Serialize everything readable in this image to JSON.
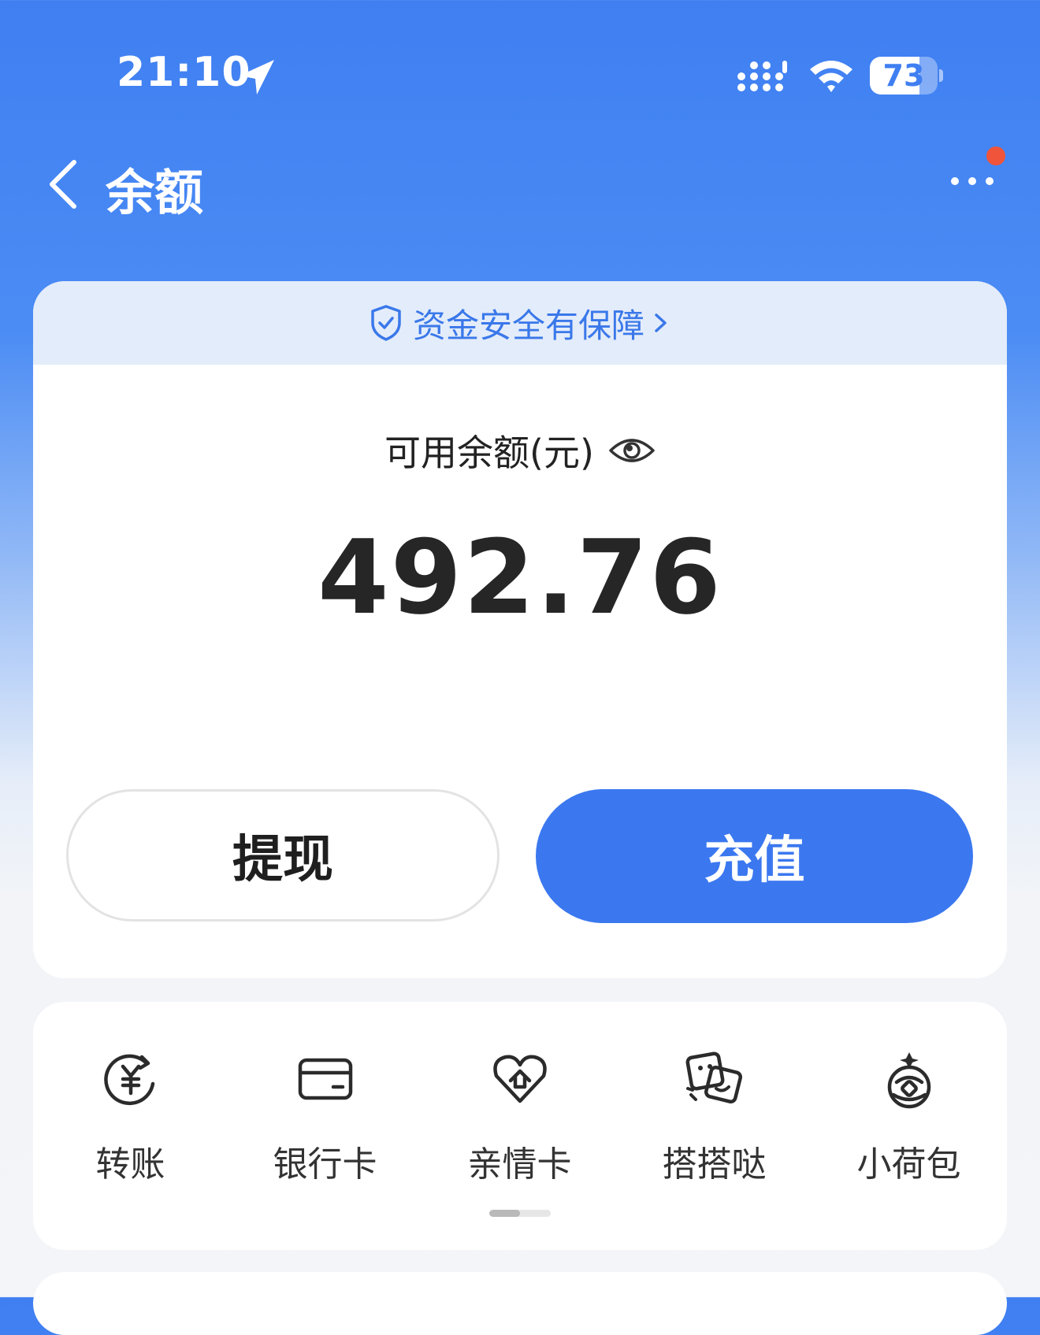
{
  "status_bar": {
    "time": "21:10",
    "battery_level": "73",
    "battery_fraction": 0.73
  },
  "header": {
    "title": "余额"
  },
  "balance_card": {
    "safety_banner": "资金安全有保障",
    "balance_label": "可用余额(元)",
    "balance_amount": "492.76",
    "withdraw_label": "提现",
    "topup_label": "充值"
  },
  "shortcuts": {
    "items": [
      {
        "label": "转账",
        "icon": "transfer-yuan-icon"
      },
      {
        "label": "银行卡",
        "icon": "bank-card-icon"
      },
      {
        "label": "亲情卡",
        "icon": "family-card-heart-icon"
      },
      {
        "label": "搭搭哒",
        "icon": "dadada-cards-icon"
      },
      {
        "label": "小荷包",
        "icon": "small-purse-icon"
      }
    ],
    "page_indicator": {
      "current": 1,
      "total": 2
    }
  },
  "colors": {
    "brand_blue": "#3b78f0",
    "header_gradient_top": "#3f7ff2",
    "notification_dot": "#f0553b",
    "safety_text": "#3a78ea"
  }
}
